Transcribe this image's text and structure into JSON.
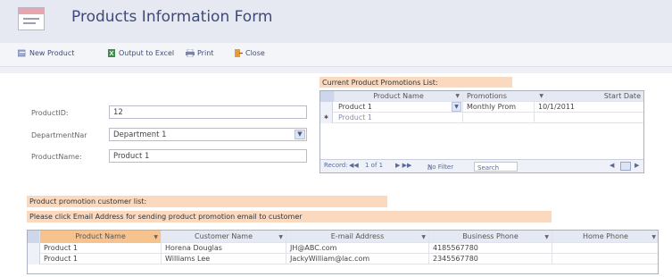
{
  "header": {
    "title": "Products Information Form"
  },
  "toolbar": {
    "new_product": "New Product",
    "output_excel": "Output to Excel",
    "print": "Print",
    "close": "Close"
  },
  "form": {
    "product_id_label": "ProductID:",
    "product_id_value": "12",
    "department_label": "DepartmentNar",
    "department_value": "Department 1",
    "product_name_label": "ProductName:",
    "product_name_value": "Product 1"
  },
  "promotions": {
    "heading": "Current Product Promotions List:",
    "columns": [
      "Product Name",
      "Promotions",
      "Start Date"
    ],
    "rows": [
      {
        "product": "Product 1",
        "promotion": "Monthly Prom",
        "start": "10/1/2011"
      },
      {
        "product": "Product 1",
        "promotion": "",
        "start": ""
      }
    ],
    "nav": {
      "record_label": "Record:",
      "record_pos": "1 of 1",
      "filter": "No Filter",
      "search": "Search"
    }
  },
  "customers": {
    "heading": "Product promotion customer list:",
    "instruction": "Please click Email Address for sending product promotion email to customer",
    "columns": [
      "Product Name",
      "Customer Name",
      "E-mail Address",
      "Business Phone",
      "Home Phone"
    ],
    "rows": [
      {
        "product": "Product 1",
        "customer": "Horena Douglas",
        "email": "JH@ABC.com",
        "business": "4185567780",
        "home": ""
      },
      {
        "product": "Product 1",
        "customer": "Williams Lee",
        "email": "JackyWilliam@lac.com",
        "business": "2345567780",
        "home": ""
      }
    ]
  },
  "colors": {
    "title": "#3d4a7a",
    "accent_orange": "#fbd9bf",
    "header_bg": "#e6e9f1"
  }
}
